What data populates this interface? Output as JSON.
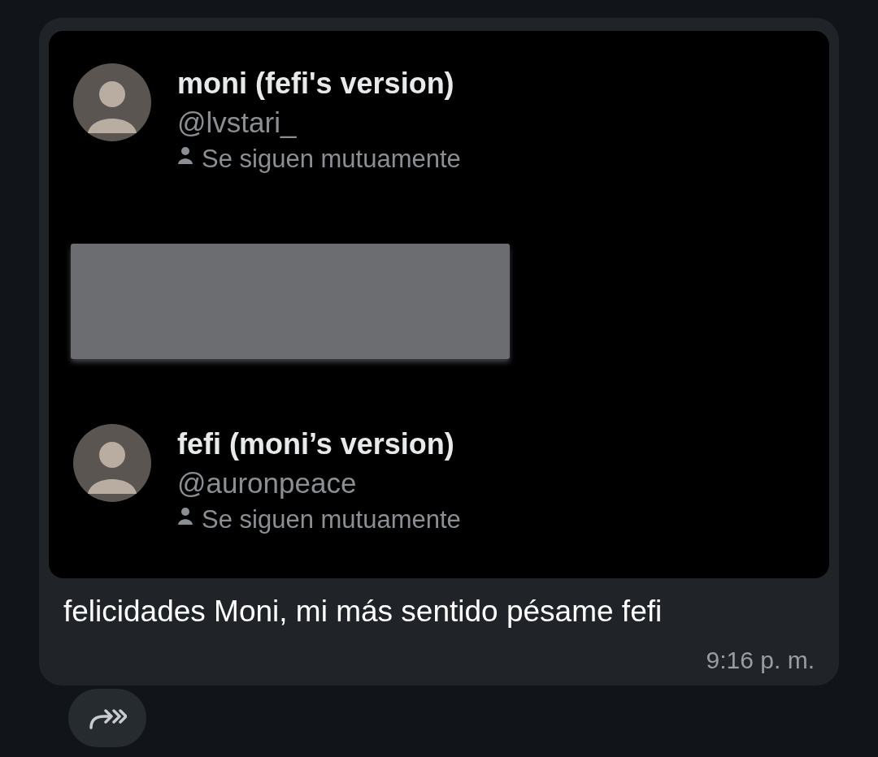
{
  "message": {
    "embed": {
      "profiles": [
        {
          "kind": "profile",
          "name": "moni (fefi's version)",
          "handle": "@lvstari_",
          "relation": "Se siguen mutuamente"
        },
        {
          "kind": "redacted"
        },
        {
          "kind": "profile",
          "name": "fefi (moni’s version)",
          "handle": "@auronpeace",
          "relation": "Se siguen mutuamente"
        }
      ]
    },
    "text": "felicidades Moni, mi más sentido pésame fefi",
    "time": "9:16 p. m."
  }
}
